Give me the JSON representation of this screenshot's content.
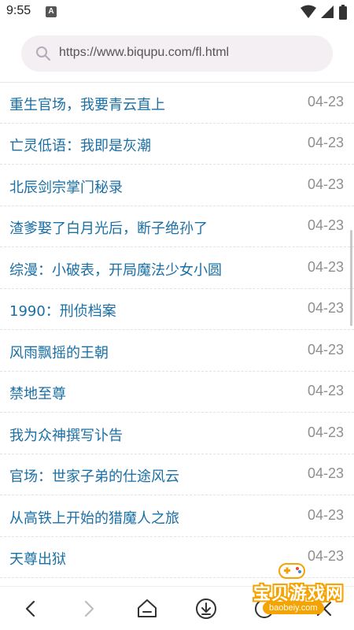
{
  "status_bar": {
    "time": "9:55",
    "app_badge": "A",
    "icons": [
      "wifi-icon",
      "signal-icon",
      "battery-icon"
    ]
  },
  "search": {
    "url": "https://www.biqupu.com/fl.html"
  },
  "list": {
    "items": [
      {
        "title": "重生官场，我要青云直上",
        "date": "04-23"
      },
      {
        "title": "亡灵低语：我即是灰潮",
        "date": "04-23"
      },
      {
        "title": "北辰剑宗掌门秘录",
        "date": "04-23"
      },
      {
        "title": "渣爹娶了白月光后，断子绝孙了",
        "date": "04-23"
      },
      {
        "title": "综漫：小破表，开局魔法少女小圆",
        "date": "04-23"
      },
      {
        "title": "1990：刑侦档案",
        "date": "04-23"
      },
      {
        "title": "风雨飘摇的王朝",
        "date": "04-23"
      },
      {
        "title": "禁地至尊",
        "date": "04-23"
      },
      {
        "title": "我为众神撰写讣告",
        "date": "04-23"
      },
      {
        "title": "官场：世家子弟的仕途风云",
        "date": "04-23"
      },
      {
        "title": "从高铁上开始的猎魔人之旅",
        "date": "04-23"
      },
      {
        "title": "天尊出狱",
        "date": "04-23"
      }
    ]
  },
  "bottom_bar": {
    "buttons": [
      "back-icon",
      "forward-icon",
      "home-icon",
      "download-icon",
      "menu-icon",
      "close-icon"
    ]
  },
  "watermark": {
    "title": "宝贝游戏网",
    "url": "baobeiy.com"
  },
  "colors": {
    "title_link": "#1a6fa5",
    "date": "#8f8f8f",
    "search_bg": "#f3eff3",
    "watermark": "#f5a300"
  }
}
